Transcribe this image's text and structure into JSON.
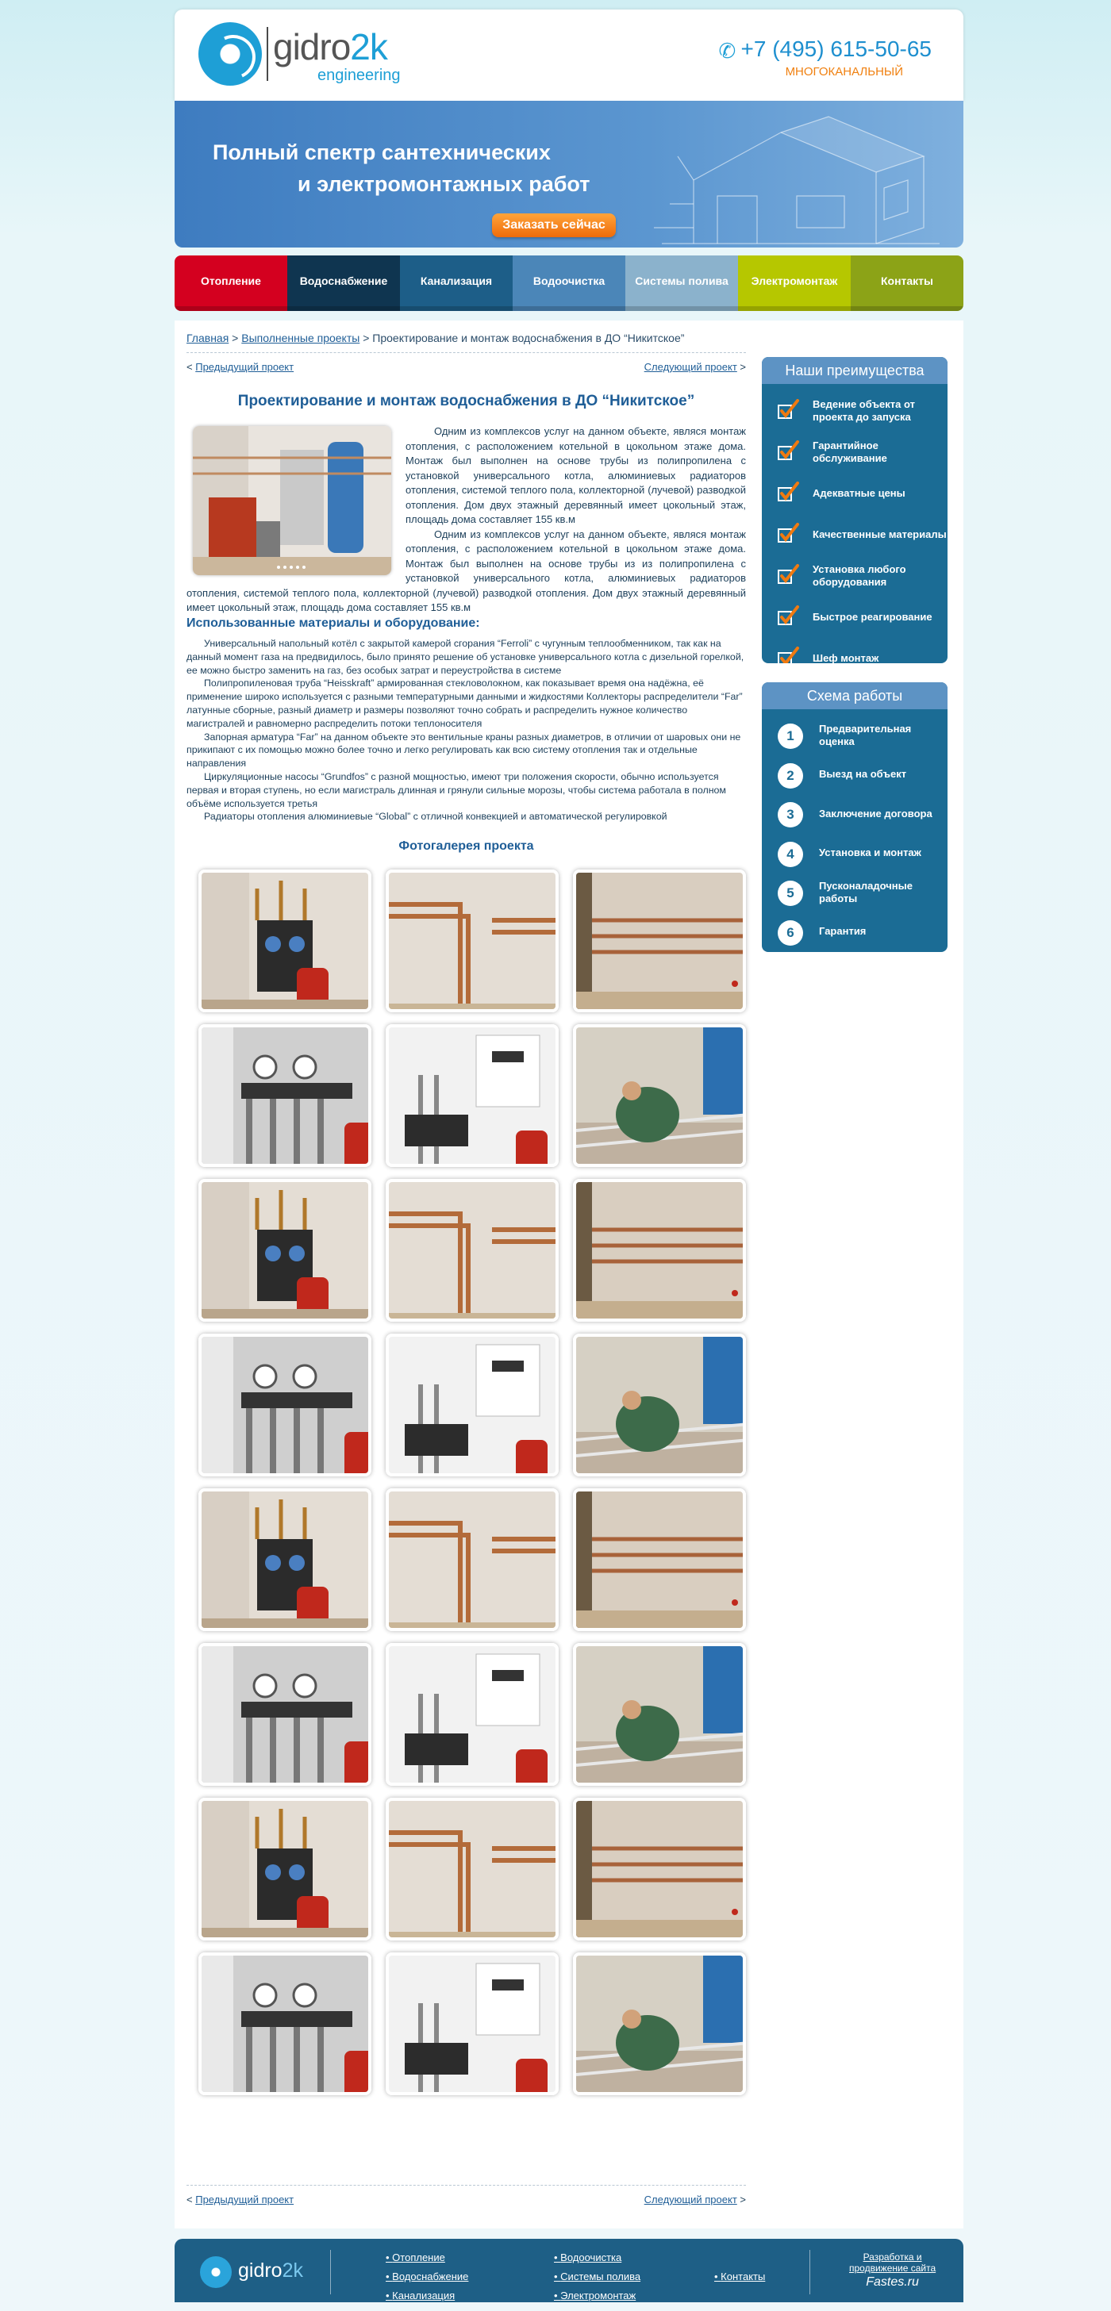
{
  "header": {
    "logo_main": "gidro",
    "logo_accent": "2k",
    "logo_sub": "engineering",
    "phone": "+7 (495) 615-50-65",
    "phone_note": "МНОГОКАНАЛЬНЫЙ"
  },
  "banner": {
    "line1": "Полный спектр сантехнических",
    "line2": "и электромонтажных работ",
    "button": "Заказать сейчас"
  },
  "nav": {
    "items": [
      {
        "label": "Отопление",
        "color": "#d4001f"
      },
      {
        "label": "Водоснабжение",
        "color": "#0f3550"
      },
      {
        "label": "Канализация",
        "color": "#1d5e88"
      },
      {
        "label": "Водоочистка",
        "color": "#4b86b8"
      },
      {
        "label": "Системы полива",
        "color": "#8bb2cc"
      },
      {
        "label": "Электромонтаж",
        "color": "#b6c700"
      },
      {
        "label": "Контакты",
        "color": "#8ca317"
      }
    ]
  },
  "breadcrumb": {
    "home": "Главная",
    "sep1": " > ",
    "section": "Выполненные проекты",
    "sep2": " > ",
    "current": "Проектирование и монтаж водоснабжения в ДО “Никитское”"
  },
  "pager": {
    "prev_mark": "< ",
    "prev": "Предыдущий проект",
    "next": "Следующий проект",
    "next_mark": " >"
  },
  "article": {
    "title": "Проектирование и монтаж водоснабжения в ДО “Никитское”",
    "p1": "Одним из комплексов услуг на данном объекте, являся монтаж отопления, с расположением котельной в цокольном этаже дома. Монтаж был выполнен на основе трубы из полипропилена с установкой универсального котла, алюминиевых радиаторов отопления, системой теплого пола, коллекторной (лучевой) разводкой отопления. Дом двух этажный деревянный имеет цокольный этаж, площадь дома составляет 155 кв.м",
    "p2": "Одним из комплексов услуг на данном объекте, являся монтаж отопления, с расположением котельной в цокольном этаже дома. Монтаж был выполнен на основе трубы из из полипропилена с установкой универсального котла, алюминиевых радиаторов отопления, системой теплого пола, коллекторной (лучевой) разводкой отопления. Дом двух этажный деревянный имеет цокольный этаж, площадь дома составляет 155 кв.м",
    "materials_title": "Использованные материалы и оборудование:",
    "materials": [
      "Универсальный напольный котёл с закрытой камерой сгорания “Ferroli” с чугунным теплообменником, так как на данный момент газа на предвидилось, было принято решение об установке универсального котла с дизельной горелкой, ее можно быстро заменить на газ, без особых затрат и переустройства в системе",
      "Полипропиленовая труба “Heisskraft” армированная стекловолокном, как показывает время она надёжна, её применение широко используется с разными температурными данными и жидкостями Коллекторы распределители “Far” латунные сборные, разный диаметр и размеры позволяют точно собрать и распределить нужное количество магистралей и равномерно распределить потоки теплоносителя",
      "Запорная арматура “Far” на данном объекте это вентильные краны разных диаметров, в отличии от шаровых они не прикипают с их помощью можно более точно и легко регулировать как всю систему отопления так и отдельные направления",
      "Циркуляционные насосы “Grundfos” с разной мощностью, имеют три положения скорости, обычно используется первая и вторая ступень, но если магистраль длинная и грянули сильные морозы, чтобы система работала в полном объёме используется третья",
      "Радиаторы отопления алюминиевые “Global” с отличной конвекцией и автоматической регулировкой"
    ],
    "gallery_title": "Фотогалерея проекта"
  },
  "gallery": {
    "photos": [
      "boiler-room",
      "pipes-wall",
      "pipes-wall-close",
      "manifold",
      "boiler",
      "floor-work",
      "boiler-room",
      "pipes-wall",
      "pipes-wall-close",
      "manifold",
      "boiler",
      "floor-work",
      "boiler-room",
      "pipes-wall",
      "pipes-wall-close",
      "manifold",
      "boiler",
      "floor-work",
      "boiler-room",
      "pipes-wall",
      "pipes-wall-close",
      "manifold",
      "boiler",
      "floor-work"
    ]
  },
  "advantages": {
    "title": "Наши преимущества",
    "items": [
      "Ведение объекта от проекта до запуска",
      "Гарантийное обслуживание",
      "Адекватные цены",
      "Качественные материалы",
      "Установка любого оборудования",
      "Быстрое реагирование",
      "Шеф монтаж"
    ]
  },
  "scheme": {
    "title": "Схема работы",
    "steps": [
      {
        "n": "1",
        "label": "Предварительная оценка"
      },
      {
        "n": "2",
        "label": "Выезд на объект"
      },
      {
        "n": "3",
        "label": "Заключение договора"
      },
      {
        "n": "4",
        "label": "Установка и монтаж"
      },
      {
        "n": "5",
        "label": "Пусконаладочные работы"
      },
      {
        "n": "6",
        "label": "Гарантия"
      }
    ]
  },
  "footer": {
    "logo_main": "gidro",
    "logo_accent": "2k",
    "col1": [
      "Отопление",
      "Водоснабжение",
      "Канализация"
    ],
    "col2": [
      "Водоочистка",
      "Системы полива",
      "Электромонтаж"
    ],
    "col3": [
      "Контакты"
    ],
    "dev_line1": "Разработка и",
    "dev_line2": "продвижение сайта",
    "dev_brand": "Fastes.ru"
  }
}
